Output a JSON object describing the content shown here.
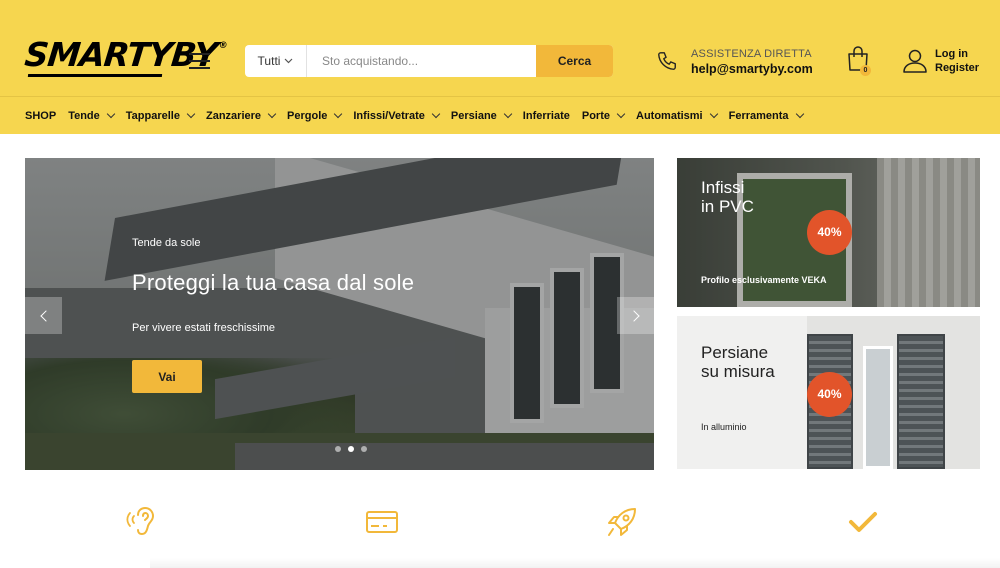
{
  "brand": {
    "logo_text": "SMARTYBY",
    "logo_mark": "®",
    "primary_color": "#f6d64f",
    "accent_color": "#f2b83a",
    "badge_color": "#e2542a"
  },
  "header": {
    "menu_icon": "hamburger-icon",
    "search": {
      "category": "Tutti",
      "placeholder": "Sto acquistando...",
      "button": "Cerca"
    },
    "assistance": {
      "label": "ASSISTENZA DIRETTA",
      "email": "help@smartyby.com",
      "icon": "phone-icon"
    },
    "cart": {
      "count": "0",
      "icon": "shopping-bag-icon"
    },
    "account": {
      "line1": "Log in",
      "line2": "Register",
      "icon": "user-icon"
    }
  },
  "nav": {
    "items": [
      {
        "label": "SHOP",
        "dropdown": false
      },
      {
        "label": "Tende",
        "dropdown": true
      },
      {
        "label": "Tapparelle",
        "dropdown": true
      },
      {
        "label": "Zanzariere",
        "dropdown": true
      },
      {
        "label": "Pergole",
        "dropdown": true
      },
      {
        "label": "Infissi/Vetrate",
        "dropdown": true
      },
      {
        "label": "Persiane",
        "dropdown": true
      },
      {
        "label": "Inferriate",
        "dropdown": false
      },
      {
        "label": "Porte",
        "dropdown": true
      },
      {
        "label": "Automatismi",
        "dropdown": true
      },
      {
        "label": "Ferramenta",
        "dropdown": true
      }
    ]
  },
  "hero": {
    "eyebrow": "Tende da sole",
    "title": "Proteggi la tua casa dal sole",
    "subtitle": "Per vivere estati freschissime",
    "cta": "Vai",
    "slides": 3,
    "active_slide": 2
  },
  "promos": [
    {
      "heading_line1": "Infissi",
      "heading_line2": "in PVC",
      "badge": "40%",
      "caption": "Profilo esclusivamente VEKA"
    },
    {
      "heading_line1": "Persiane",
      "heading_line2": "su misura",
      "badge": "40%",
      "caption": "In alluminio"
    }
  ],
  "features": [
    {
      "icon": "ear-listening-icon"
    },
    {
      "icon": "credit-card-icon"
    },
    {
      "icon": "rocket-icon"
    },
    {
      "icon": "checkmark-icon"
    }
  ]
}
